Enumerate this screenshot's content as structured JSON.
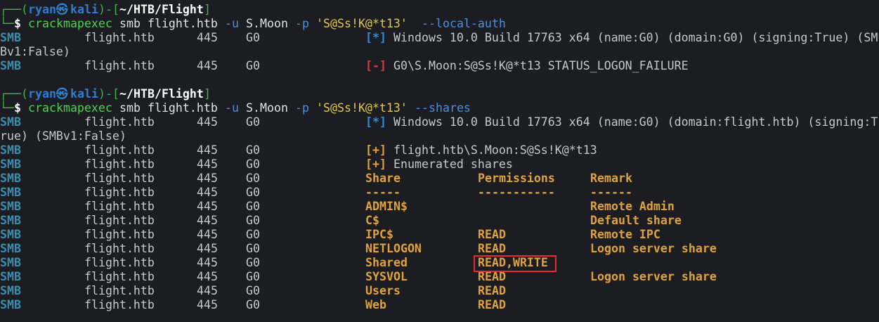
{
  "prompt": {
    "user": "ryan",
    "host": "kali",
    "at_symbol": "㉿",
    "path": "~/HTB/Flight",
    "top_left": "┌──(",
    "mid": ")-[",
    "close": "]",
    "bottom_left": "└─",
    "dollar": "$"
  },
  "commands": [
    {
      "exe": "crackmapexec",
      "args_before": "smb flight.htb",
      "flag_u": "-u",
      "user": "S.Moon",
      "flag_p": "-p",
      "password": "'S@Ss!K@*t13'",
      "extra": "--local-auth"
    },
    {
      "exe": "crackmapexec",
      "args_before": "smb flight.htb",
      "flag_u": "-u",
      "user": "S.Moon",
      "flag_p": "-p",
      "password": "'S@Ss!K@*t13'",
      "extra": "--shares"
    }
  ],
  "smb_common": {
    "proto": "SMB",
    "host": "flight.htb",
    "port": "445",
    "name": "G0"
  },
  "output1": {
    "line1_tag": "[*]",
    "line1_text": "Windows 10.0 Build 17763 x64 (name:G0) (domain:G0) (signing:True) (SM",
    "line1_wrap": "Bv1:False)",
    "line2_tag": "[-]",
    "line2_text": "G0\\S.Moon:S@Ss!K@*t13 STATUS_LOGON_FAILURE"
  },
  "output2": {
    "line1_tag": "[*]",
    "line1_text": "Windows 10.0 Build 17763 x64 (name:G0) (domain:flight.htb) (signing:T",
    "line1_wrap": "rue) (SMBv1:False)",
    "line2_tag": "[+]",
    "line2_text": "flight.htb\\S.Moon:S@Ss!K@*t13",
    "line3_tag": "[+]",
    "line3_text": "Enumerated shares",
    "headers": {
      "share": "Share",
      "perm": "Permissions",
      "remark": "Remark"
    },
    "dashes": {
      "share": "-----",
      "perm": "-----------",
      "remark": "------"
    },
    "shares": [
      {
        "share": "ADMIN$",
        "perm": "",
        "remark": "Remote Admin"
      },
      {
        "share": "C$",
        "perm": "",
        "remark": "Default share"
      },
      {
        "share": "IPC$",
        "perm": "READ",
        "remark": "Remote IPC"
      },
      {
        "share": "NETLOGON",
        "perm": "READ",
        "remark": "Logon server share"
      },
      {
        "share": "Shared",
        "perm": "READ,WRITE",
        "remark": ""
      },
      {
        "share": "SYSVOL",
        "perm": "READ",
        "remark": "Logon server share"
      },
      {
        "share": "Users",
        "perm": "READ",
        "remark": ""
      },
      {
        "share": "Web",
        "perm": "READ",
        "remark": ""
      }
    ]
  }
}
